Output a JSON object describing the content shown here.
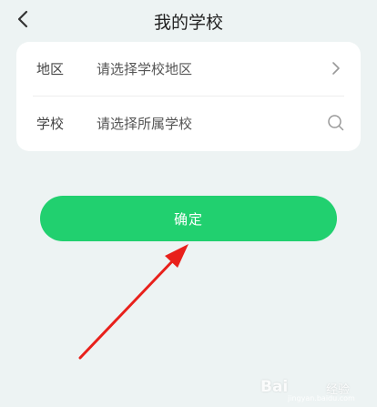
{
  "header": {
    "title": "我的学校",
    "back_icon": "chevron-left-icon"
  },
  "form": {
    "region": {
      "label": "地区",
      "placeholder": "请选择学校地区",
      "icon": "chevron-right-icon"
    },
    "school": {
      "label": "学校",
      "placeholder": "请选择所属学校",
      "icon": "search-icon"
    }
  },
  "confirm_button": {
    "label": "确定",
    "color": "#21d06f"
  },
  "annotation": {
    "arrow_color": "#e8201b"
  },
  "watermark": {
    "brand": "Bai",
    "sub": "经验",
    "url": "jingyan.baidu.com"
  },
  "colors": {
    "background": "#edf3f3",
    "card": "#ffffff"
  }
}
